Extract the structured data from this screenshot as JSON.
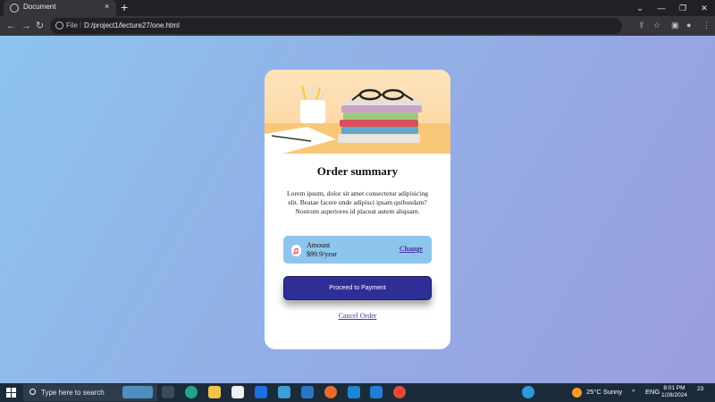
{
  "browser": {
    "tab_title": "Document",
    "tab_close": "×",
    "new_tab": "+",
    "window_buttons": [
      "⌄",
      "—",
      "❐",
      "✕"
    ],
    "nav": {
      "back": "←",
      "forward": "→",
      "reload": "↻"
    },
    "url_scheme": "File",
    "url_separator": "|",
    "url": "D:/project1/lecture27/one.html",
    "toolbar_icons": [
      "⇪",
      "☆",
      "▣",
      "●",
      "⋮"
    ]
  },
  "card": {
    "title": "Order summary",
    "description": "Lorem ipsum, dolor sit amet consectetur adipisicing elit. Beatae facere unde adipisci ipsam quibusdam? Nostrum asperiores id placeat autem aliquam.",
    "plan_label": "Amount",
    "plan_price": "$99.9/year",
    "change_link": "Change",
    "pay_button": "Proceed to Payment",
    "cancel_link": "Cancel Order",
    "colors": {
      "plan_bg": "#8ec5ec",
      "button": "#2f2e96",
      "link": "#4b2fa8"
    }
  },
  "taskbar": {
    "search_placeholder": "Type here to search",
    "weather": "25°C  Sunny",
    "language": "ENG",
    "time": "8:01 PM",
    "date": "1/28/2024",
    "notification_count": "23"
  }
}
